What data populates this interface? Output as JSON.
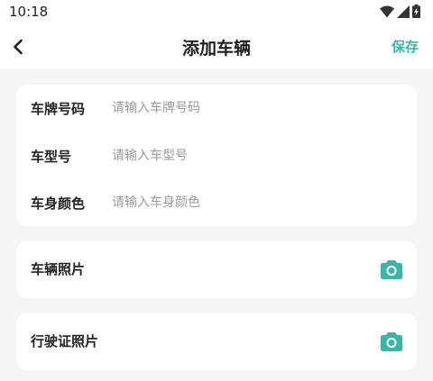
{
  "status_bar": {
    "time": "10:18",
    "icons": [
      "wifi-icon",
      "signal-icon",
      "battery-icon"
    ]
  },
  "header": {
    "back_icon": "chevron-left-icon",
    "title": "添加车辆",
    "save_label": "保存"
  },
  "colors": {
    "accent": "#35b8a8",
    "background": "#f5f5f5",
    "card": "#ffffff",
    "placeholder": "#9a9a9a"
  },
  "vehicle_form": {
    "plate": {
      "label": "车牌号码",
      "value": "",
      "placeholder": "请输入车牌号码"
    },
    "model": {
      "label": "车型号",
      "value": "",
      "placeholder": "请输入车型号"
    },
    "color": {
      "label": "车身颜色",
      "value": "",
      "placeholder": "请输入车身颜色"
    }
  },
  "photos": {
    "vehicle_photo": {
      "label": "车辆照片",
      "icon": "camera-icon"
    },
    "license_photo": {
      "label": "行驶证照片",
      "icon": "camera-icon"
    }
  }
}
